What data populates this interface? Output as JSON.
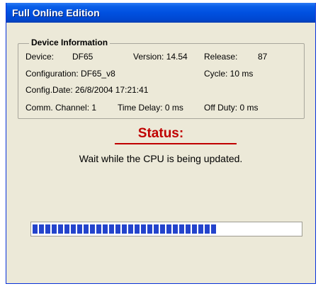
{
  "window": {
    "title": "Full Online Edition"
  },
  "device_info": {
    "group_title": "Device Information",
    "device_label": "Device:",
    "device_value": "DF65",
    "version_label": "Version: 14.54",
    "release_label": "Release:",
    "release_value": "87",
    "configuration": "Configuration:  DF65_v8",
    "cycle": "Cycle: 10 ms",
    "config_date": "Config.Date:  26/8/2004 17:21:41",
    "comm_channel": "Comm. Channel: 1",
    "time_delay": "Time Delay:  0 ms",
    "off_duty": "Off Duty:  0 ms"
  },
  "status": {
    "label": "Status:",
    "message": "Wait while the CPU is being updated.",
    "accent_color": "#c00000"
  },
  "progress": {
    "fraction": 0.69,
    "color": "#2444cc"
  }
}
